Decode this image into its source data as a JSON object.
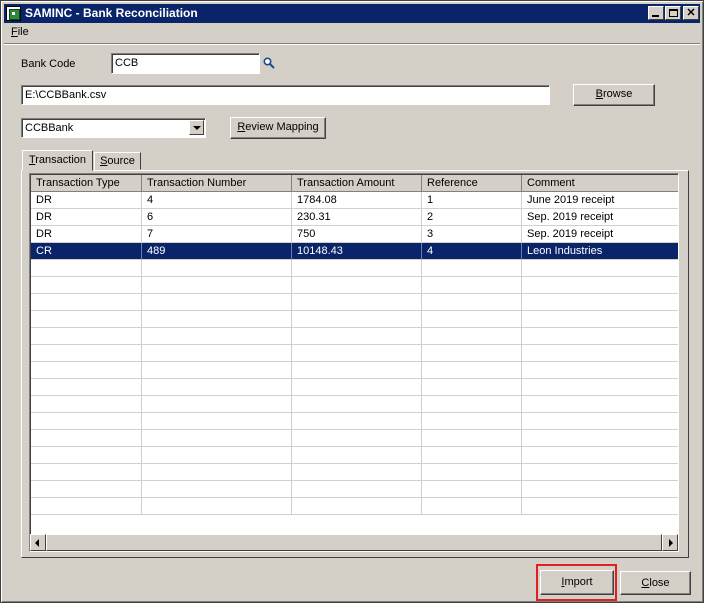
{
  "window": {
    "title": "SAMINC - Bank Reconciliation"
  },
  "titlebar_buttons": {
    "minimize": "_",
    "maximize": "□",
    "close": "✕"
  },
  "menu": {
    "file_label": "File",
    "file_mnemonic": "F",
    "file_rest": "ile"
  },
  "bank_code": {
    "label": "Bank Code",
    "value": "CCB"
  },
  "file_path": {
    "value": "E:\\CCBBank.csv"
  },
  "browse_button": {
    "mnemonic": "B",
    "rest": "rowse"
  },
  "mapping_combo": {
    "value": "CCBBank"
  },
  "review_mapping_button": {
    "mnemonic": "R",
    "rest": "eview Mapping"
  },
  "tabs": [
    {
      "mnemonic": "T",
      "rest": "ransaction",
      "active": true
    },
    {
      "mnemonic": "S",
      "rest": "ource",
      "active": false
    }
  ],
  "grid": {
    "columns": [
      "Transaction Type",
      "Transaction Number",
      "Transaction Amount",
      "Reference",
      "Comment"
    ],
    "rows": [
      [
        "DR",
        "4",
        "1784.08",
        "1",
        "June 2019 receipt"
      ],
      [
        "DR",
        "6",
        "230.31",
        "2",
        "Sep. 2019 receipt"
      ],
      [
        "DR",
        "7",
        "750",
        "3",
        "Sep. 2019 receipt"
      ],
      [
        "CR",
        "489",
        "10148.43",
        "4",
        "Leon Industries"
      ]
    ],
    "selected_row_index": 3,
    "empty_row_count": 15
  },
  "import_button": {
    "mnemonic": "I",
    "rest": "mport"
  },
  "close_button": {
    "mnemonic": "C",
    "rest": "lose"
  },
  "colors": {
    "title_bar": "#0a246a",
    "selection": "#0a246a",
    "face": "#d4d0c8",
    "highlight_box": "#e02020"
  },
  "icons": {
    "search": "magnifier-icon",
    "app": "app-icon"
  }
}
